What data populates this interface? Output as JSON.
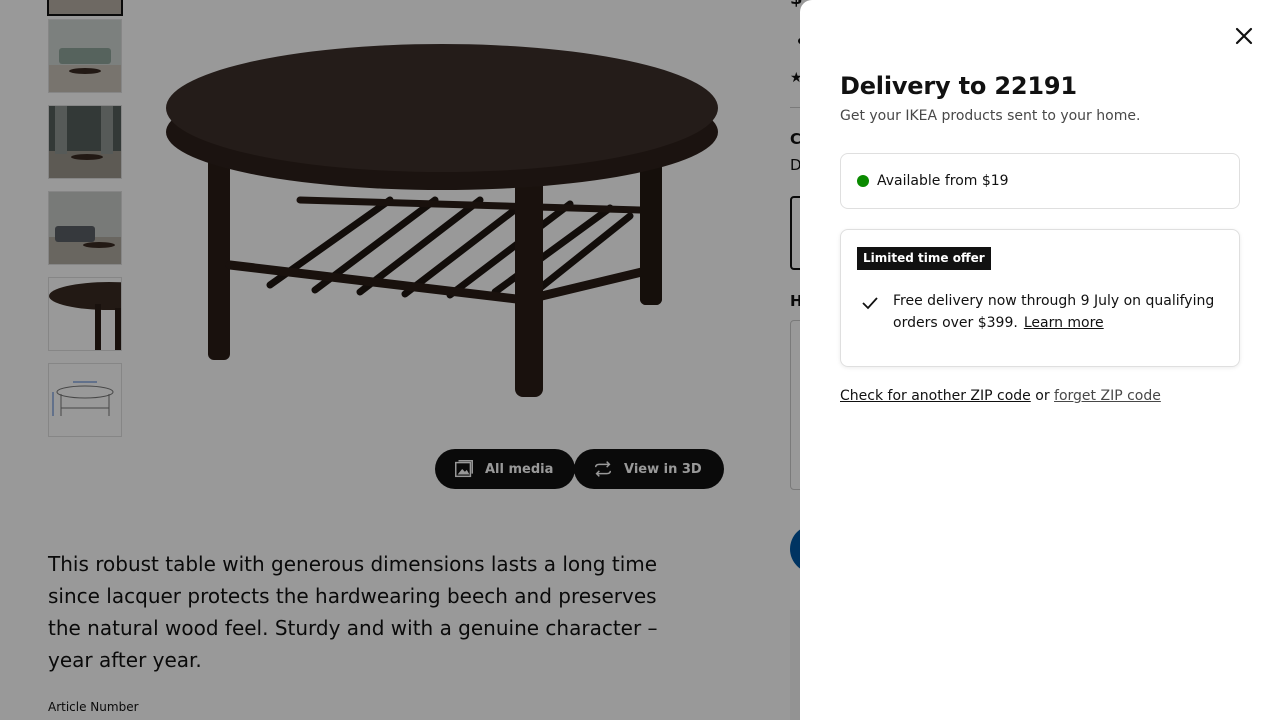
{
  "gallery": {
    "thumbnails": [
      "thumb-1",
      "thumb-2",
      "thumb-3",
      "thumb-4",
      "thumb-5",
      "thumb-6"
    ]
  },
  "media_buttons": {
    "all_media": "All media",
    "view_3d": "View in 3D"
  },
  "product": {
    "description": "This robust table with generous dimensions lasts a long time since lacquer protects the hardwearing beech and preserves the natural wood feel. Sturdy and with a genuine character – year after year.",
    "article_label": "Article Number"
  },
  "background_column": {
    "price_peek": "$",
    "star": "★",
    "c_peek": "C",
    "d_peek": "D",
    "h_peek": "H"
  },
  "delivery_panel": {
    "title": "Delivery to 22191",
    "subtitle": "Get your IKEA products sent to your home.",
    "availability": {
      "text": "Available from $19",
      "status_color": "#0a8a00"
    },
    "offer": {
      "badge": "Limited time offer",
      "text": "Free delivery now through 9 July on qualifying orders over $399.",
      "link": "Learn more"
    },
    "zip": {
      "check_link": "Check for another ZIP code",
      "separator": "or",
      "forget_link": "forget ZIP code"
    }
  },
  "colors": {
    "scrim": "rgba(0,0,0,0.40)",
    "brand_blue": "#0058a3",
    "table_wood": "#3a2a22"
  }
}
